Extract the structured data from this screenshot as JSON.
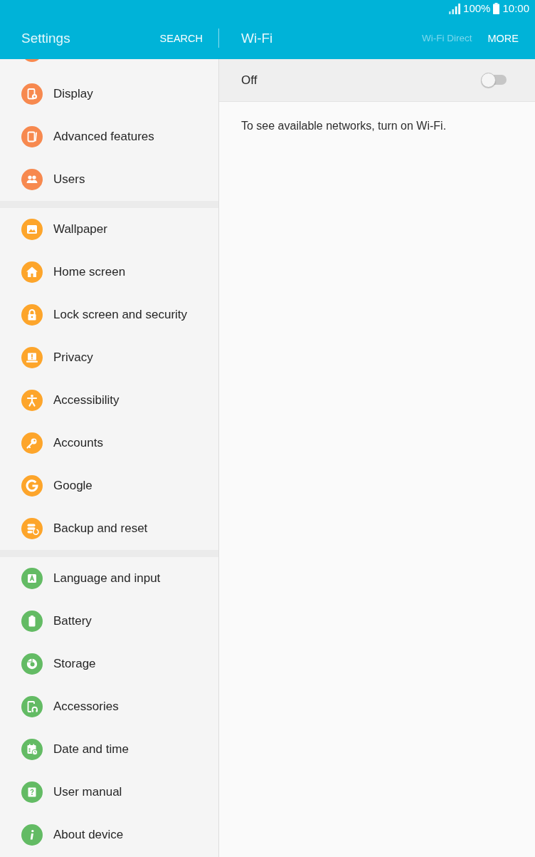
{
  "status_bar": {
    "battery": "100%",
    "time": "10:00"
  },
  "header": {
    "title": "Settings",
    "search": "SEARCH",
    "page_title": "Wi-Fi",
    "actions": [
      {
        "label": "Wi-Fi Direct",
        "disabled": true
      },
      {
        "label": "MORE",
        "disabled": false
      }
    ]
  },
  "sidebar": {
    "sections": [
      {
        "color": "#f7894f",
        "items": [
          {
            "kind": "cut_off"
          },
          {
            "kind": "entry",
            "label": "Display"
          },
          {
            "kind": "entry",
            "label": "Advanced features"
          },
          {
            "kind": "entry",
            "label": "Users"
          }
        ]
      },
      {
        "color": "#fda52b",
        "items": [
          {
            "kind": "entry",
            "label": "Wallpaper"
          },
          {
            "kind": "entry",
            "label": "Home screen"
          },
          {
            "kind": "entry",
            "label": "Lock screen and security"
          },
          {
            "kind": "entry",
            "label": "Privacy"
          },
          {
            "kind": "entry",
            "label": "Accessibility"
          },
          {
            "kind": "entry",
            "label": "Accounts"
          },
          {
            "kind": "entry",
            "label": "Google"
          },
          {
            "kind": "entry",
            "label": "Backup and reset"
          }
        ]
      },
      {
        "color": "#63bb64",
        "items": [
          {
            "kind": "entry",
            "label": "Language and input"
          },
          {
            "kind": "entry",
            "label": "Battery"
          },
          {
            "kind": "entry",
            "label": "Storage"
          },
          {
            "kind": "entry",
            "label": "Accessories"
          },
          {
            "kind": "entry",
            "label": "Date and time"
          },
          {
            "kind": "entry",
            "label": "User manual"
          },
          {
            "kind": "entry",
            "label": "About device"
          }
        ]
      }
    ]
  },
  "wifi": {
    "label": "Off",
    "on": false,
    "message": "To see available networks, turn on Wi-Fi."
  }
}
